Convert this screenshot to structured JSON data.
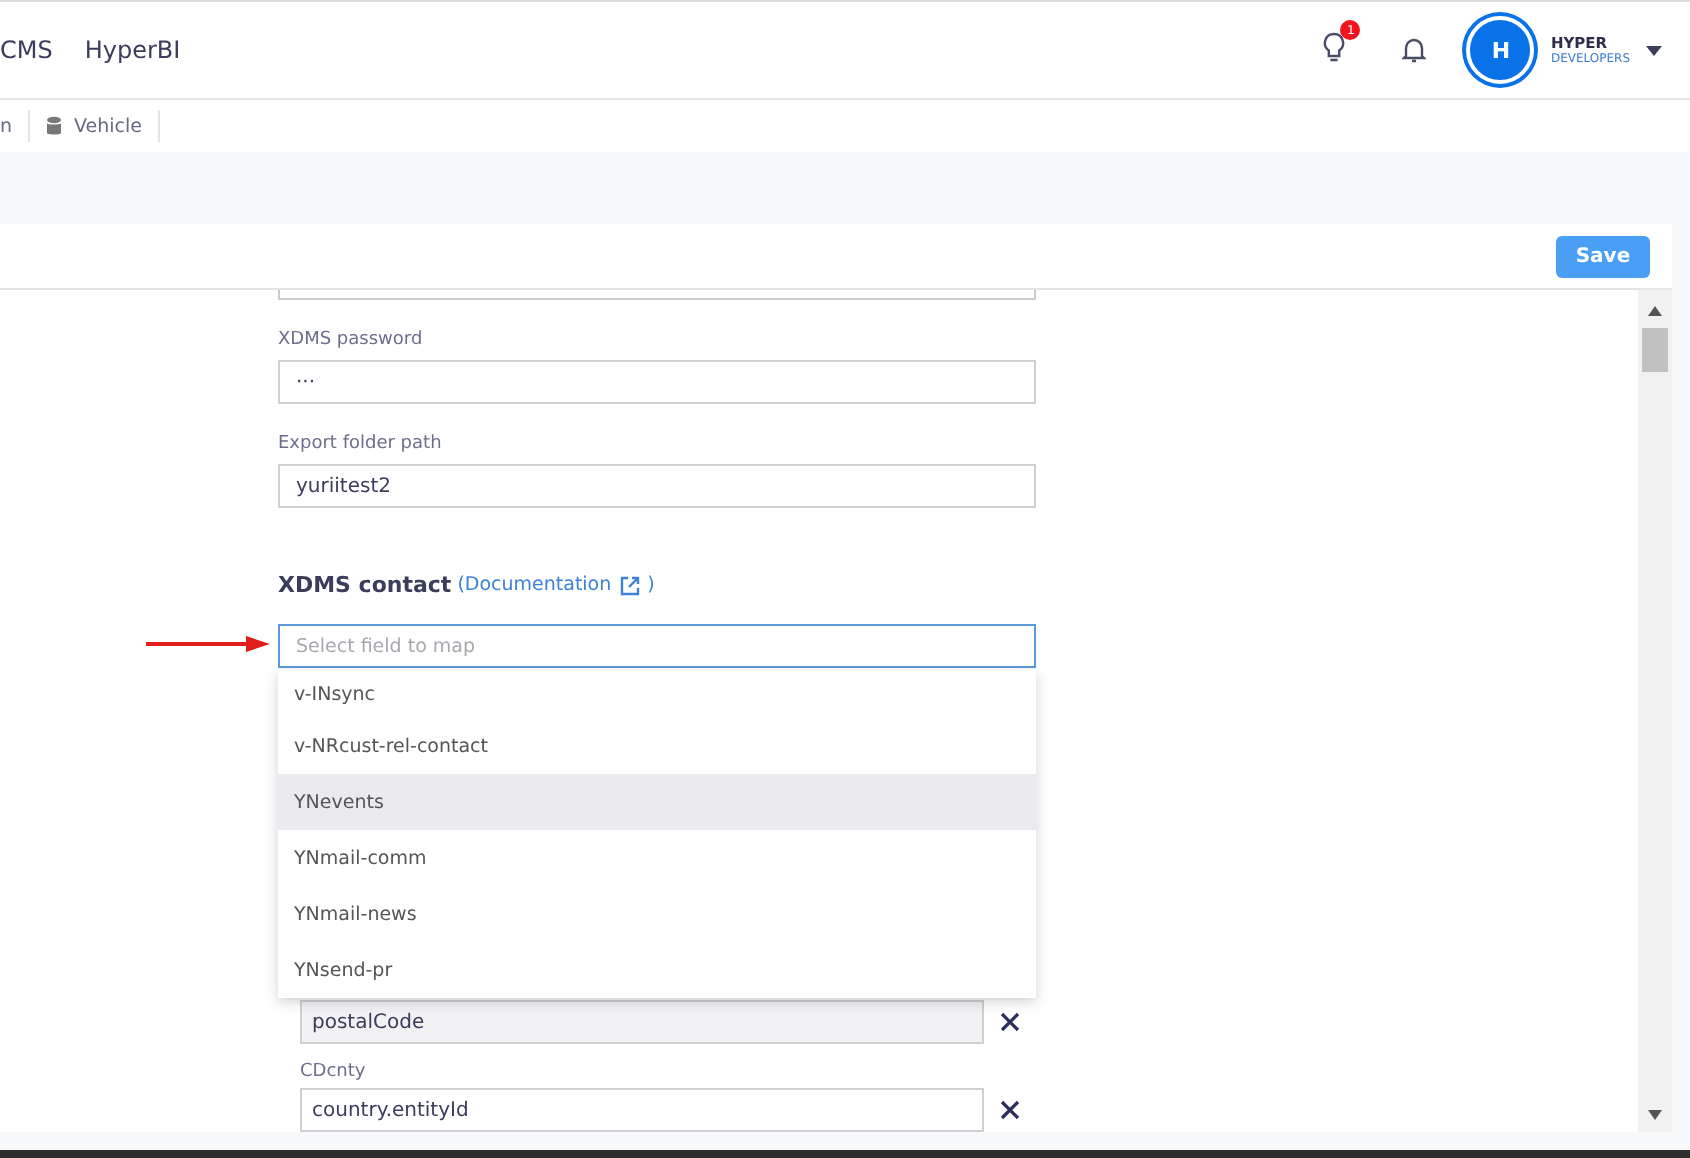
{
  "nav": {
    "links": [
      {
        "label": "CMS"
      },
      {
        "label": "HyperBI"
      }
    ],
    "notification_badge": "1",
    "user": {
      "initial": "H",
      "name": "HYPER",
      "org": "DEVELOPERS"
    }
  },
  "tabs": [
    {
      "label": "n"
    },
    {
      "label": "Vehicle"
    }
  ],
  "toolbar": {
    "save_button": "Save"
  },
  "form": {
    "fields": [
      {
        "label": "XDMS password",
        "value": "···"
      },
      {
        "label": "Export folder path",
        "value": "yuriitest2"
      }
    ],
    "section": {
      "title": "XDMS contact",
      "link": {
        "open": "(",
        "label": "Documentation",
        "close": ")"
      }
    },
    "select": {
      "placeholder": "Select field to map",
      "options": [
        {
          "label": "v-INsync",
          "selected": false
        },
        {
          "label": "v-NRcust-rel-contact",
          "selected": false
        },
        {
          "label": "YNevents",
          "selected": true
        },
        {
          "label": "YNmail-comm",
          "selected": false
        },
        {
          "label": "YNmail-news",
          "selected": false
        },
        {
          "label": "YNsend-pr",
          "selected": false
        }
      ]
    },
    "mappings": [
      {
        "value": "postalCode"
      },
      {
        "label": "CDcnty",
        "value": "country.entityId"
      }
    ]
  }
}
